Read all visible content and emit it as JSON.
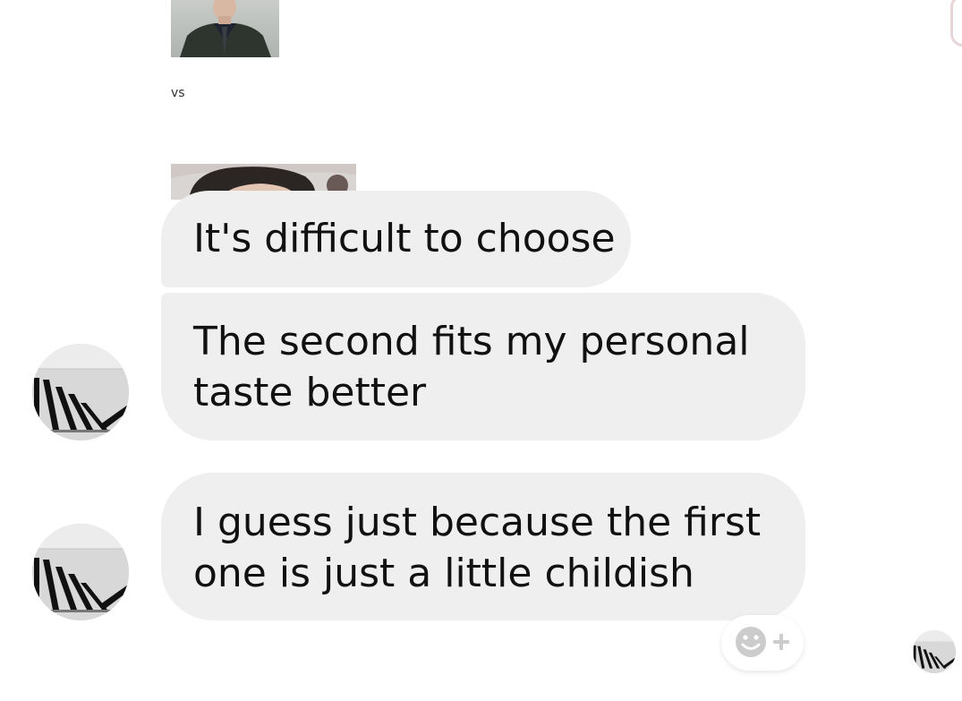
{
  "attachments": {
    "first_photo_label": "Photo of person in dark jacket",
    "separator_text": "vs",
    "second_photo_label": "Photo of person with dark curly hair"
  },
  "messages": [
    {
      "lines": [
        "It's difficult to choose"
      ]
    },
    {
      "lines": [
        "The second fits my personal",
        "taste better"
      ]
    },
    {
      "lines": [
        "I guess just because the first",
        "one is just a little childish"
      ]
    }
  ],
  "icons": {
    "avatar": "avatar-domino-icon",
    "reaction": "smiley-plus-icon"
  },
  "colors": {
    "bubble": "#efefef",
    "background": "#ffffff",
    "reaction_icon": "#cccccc"
  }
}
